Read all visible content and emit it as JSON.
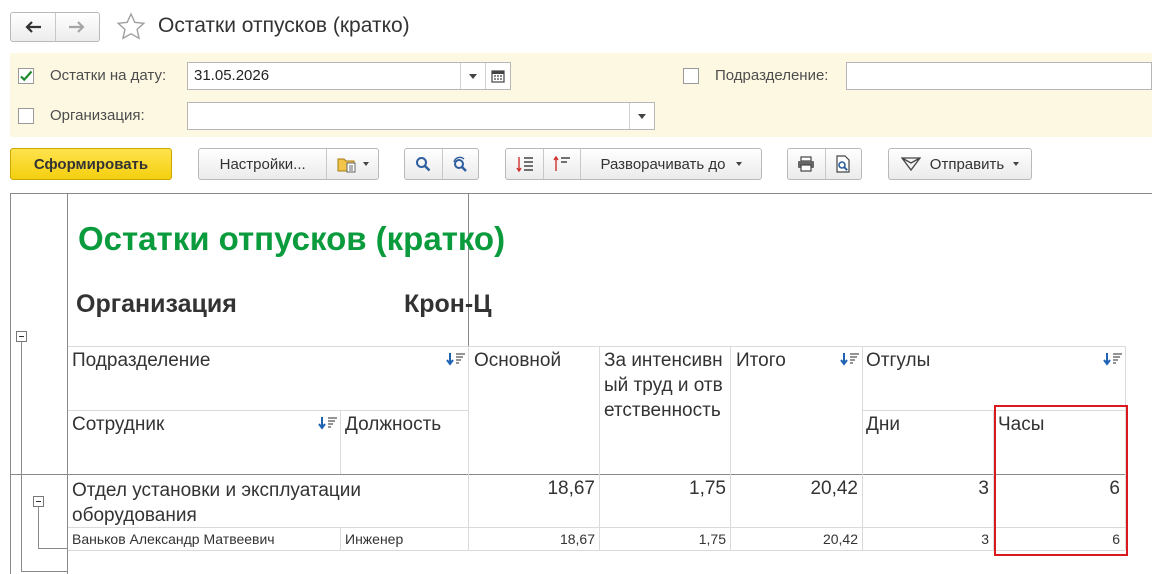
{
  "window": {
    "title": "Остатки отпусков (кратко)"
  },
  "filters": {
    "date": {
      "label": "Остатки на дату:",
      "value": "31.05.2026",
      "checked": true
    },
    "organization": {
      "label": "Организация:",
      "value": "",
      "checked": false
    },
    "department": {
      "label": "Подразделение:",
      "value": "",
      "checked": false
    }
  },
  "toolbar": {
    "generate_label": "Сформировать",
    "settings_label": "Настройки...",
    "expand_label": "Разворачивать до",
    "send_label": "Отправить"
  },
  "report": {
    "title": "Остатки отпусков (кратко)",
    "org_label": "Организация",
    "org_value": "Крон-Ц",
    "headers": {
      "department": "Подразделение",
      "employee": "Сотрудник",
      "position": "Должность",
      "main": "Основной",
      "intensive": "За интенсивный труд и ответственность",
      "total": "Итого",
      "time_off": "Отгулы",
      "days": "Дни",
      "hours": "Часы"
    },
    "group_row": {
      "department": "Отдел установки и эксплуатации оборудования",
      "main": "18,67",
      "intensive": "1,75",
      "total": "20,42",
      "days": "3",
      "hours": "6"
    },
    "detail_row": {
      "employee": "Ваньков Александр Матвеевич",
      "position": "Инженер",
      "main": "18,67",
      "intensive": "1,75",
      "total": "20,42",
      "days": "3",
      "hours": "6"
    }
  },
  "colors": {
    "title_green": "#0a9b3d",
    "primary_yellow": "#f4cf0f",
    "filter_bg": "#fcf8e1",
    "highlight_red": "#d9191e"
  }
}
